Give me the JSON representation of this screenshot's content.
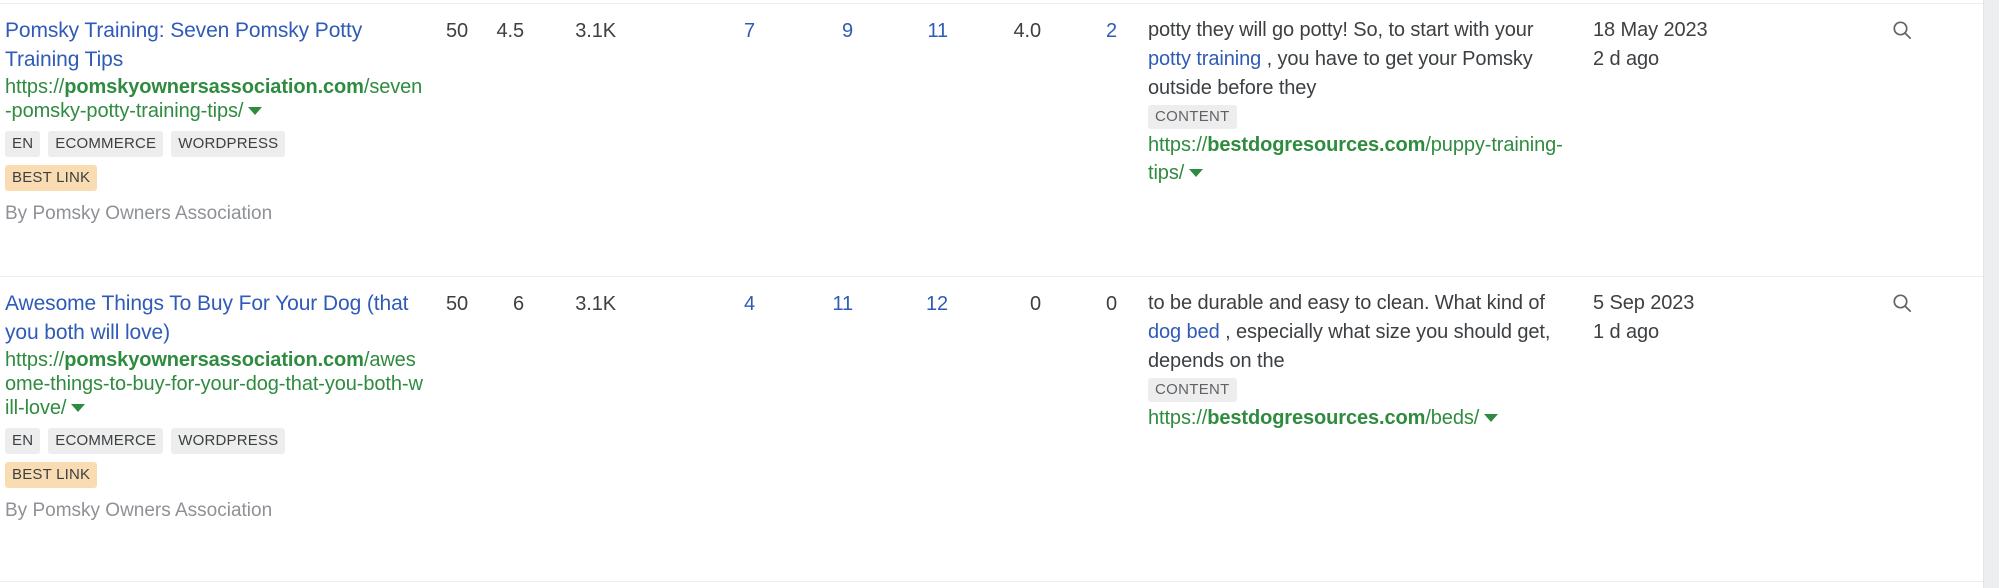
{
  "theme": {
    "link_blue": "#2f5bb7",
    "url_green": "#2f8b3f",
    "text": "#3c4043",
    "muted": "#8e9196",
    "chip_bg": "#ededed",
    "best_link_bg": "#fadcb3",
    "divider": "#eceef0",
    "gutter": "#eceef0"
  },
  "rows": [
    {
      "target": {
        "title": "Pomsky Training: Seven Pomsky Potty Training Tips",
        "url_protocol": "https://",
        "url_domain": "pomskyownersassociation.com",
        "url_path": "/seven-pomsky-potty-training-tips/",
        "chips": [
          "EN",
          "ECOMMERCE",
          "WORDPRESS"
        ],
        "best_link": "BEST LINK",
        "byline": "By Pomsky Owners Association"
      },
      "metrics": {
        "dr": "50",
        "ur": "4.5",
        "traffic": "3.1K",
        "keywords": "7",
        "linked_pages": "9",
        "ext_links_to_domain": "11",
        "links_to_domain": "4.0",
        "ref_domains": "2"
      },
      "metrics_link_flags": {
        "dr": false,
        "ur": false,
        "traffic": false,
        "keywords": true,
        "linked_pages": true,
        "ext_links_to_domain": true,
        "links_to_domain": false,
        "ref_domains": true
      },
      "anchor": {
        "text_before": "potty they will go potty! So, to start with your ",
        "anchor_link": "potty training",
        "text_after": " , you have to get your Pomsky outside before they",
        "tag": "CONTENT",
        "url_protocol": "https://",
        "url_domain": "bestdogresources.com",
        "url_path": "/puppy-training-tips/"
      },
      "date": {
        "date": "18 May 2023",
        "ago": "2 d ago"
      },
      "action": {
        "icon": "search-icon"
      }
    },
    {
      "target": {
        "title": "Awesome Things To Buy For Your Dog (that you both will love)",
        "url_protocol": "https://",
        "url_domain": "pomskyownersassociation.com",
        "url_path": "/awesome-things-to-buy-for-your-dog-that-you-both-will-love/",
        "chips": [
          "EN",
          "ECOMMERCE",
          "WORDPRESS"
        ],
        "best_link": "BEST LINK",
        "byline": "By Pomsky Owners Association"
      },
      "metrics": {
        "dr": "50",
        "ur": "6",
        "traffic": "3.1K",
        "keywords": "4",
        "linked_pages": "11",
        "ext_links_to_domain": "12",
        "links_to_domain": "0",
        "ref_domains": "0"
      },
      "metrics_link_flags": {
        "dr": false,
        "ur": false,
        "traffic": false,
        "keywords": true,
        "linked_pages": true,
        "ext_links_to_domain": true,
        "links_to_domain": false,
        "ref_domains": false
      },
      "anchor": {
        "text_before": "to be durable and easy to clean. What kind of ",
        "anchor_link": "dog bed",
        "text_after": " , especially what size you should get, depends on the",
        "tag": "CONTENT",
        "url_protocol": "https://",
        "url_domain": "bestdogresources.com",
        "url_path": "/beds/"
      },
      "date": {
        "date": "5 Sep 2023",
        "ago": "1 d ago"
      },
      "action": {
        "icon": "search-icon"
      }
    }
  ]
}
